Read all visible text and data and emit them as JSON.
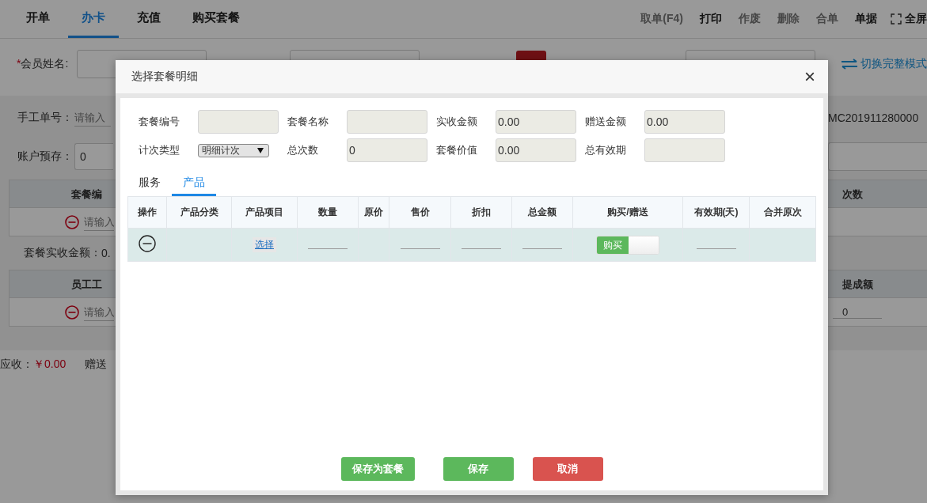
{
  "background": {
    "tabs": [
      {
        "label": "开单",
        "selected": false
      },
      {
        "label": "办卡",
        "selected": true
      },
      {
        "label": "充值",
        "selected": false
      },
      {
        "label": "购买套餐",
        "selected": false
      }
    ],
    "toolbar": [
      {
        "label": "取单(F4)",
        "disabled": true
      },
      {
        "label": "打印",
        "disabled": false
      },
      {
        "label": "作废",
        "disabled": true
      },
      {
        "label": "删除",
        "disabled": true
      },
      {
        "label": "合单",
        "disabled": true
      },
      {
        "label": "单据",
        "disabled": false
      }
    ],
    "fullscreen": "全屏",
    "member_name": {
      "required_mark": "*",
      "label": "会员姓名:"
    },
    "switch_mode": "切换完整模式",
    "manual_no": {
      "label": "手工单号：",
      "placeholder": "请输入"
    },
    "order_no": "MC201911280000",
    "account_deposit": {
      "label": "账户预存：",
      "value": "0"
    },
    "package_table": {
      "column": "套餐编",
      "count_column": "次数",
      "placeholder": "请输入"
    },
    "package_received": {
      "label": "套餐实收金额：",
      "value": "0."
    },
    "staff_table": {
      "column": "员工工",
      "commission_column": "提成额",
      "placeholder": "请输入",
      "commission_value": "0"
    },
    "receivable": {
      "label": "应收：",
      "value": "￥0.00"
    },
    "gift_label": "赠送"
  },
  "dialog": {
    "title": "选择套餐明细",
    "close": "×",
    "fields": [
      {
        "label": "套餐编号",
        "kind": "input"
      },
      {
        "label": "套餐名称",
        "kind": "input"
      },
      {
        "label": "实收金额",
        "kind": "input",
        "value": "0.00"
      },
      {
        "label": "赠送金额",
        "kind": "input",
        "value": "0.00"
      },
      {
        "label": "计次类型",
        "kind": "select",
        "value": "明细计次"
      },
      {
        "label": "总次数",
        "kind": "input",
        "value": "0"
      },
      {
        "label": "套餐价值",
        "kind": "input",
        "value": "0.00"
      },
      {
        "label": "总有效期",
        "kind": "input"
      }
    ],
    "tabs": [
      {
        "label": "服务",
        "selected": false
      },
      {
        "label": "产品",
        "selected": true
      }
    ],
    "table": {
      "columns": [
        "操作",
        "产品分类",
        "产品项目",
        "数量",
        "原价",
        "售价",
        "折扣",
        "总金额",
        "购买/赠送",
        "有效期(天)",
        "合并原次"
      ],
      "rows": [
        {
          "item_link": "选择",
          "purchase_toggle": {
            "label": "购买",
            "on": true
          }
        }
      ]
    },
    "buttons": [
      {
        "label": "保存为套餐",
        "kind": "primary"
      },
      {
        "label": "保存",
        "kind": "primary"
      },
      {
        "label": "取消",
        "kind": "danger"
      }
    ]
  }
}
